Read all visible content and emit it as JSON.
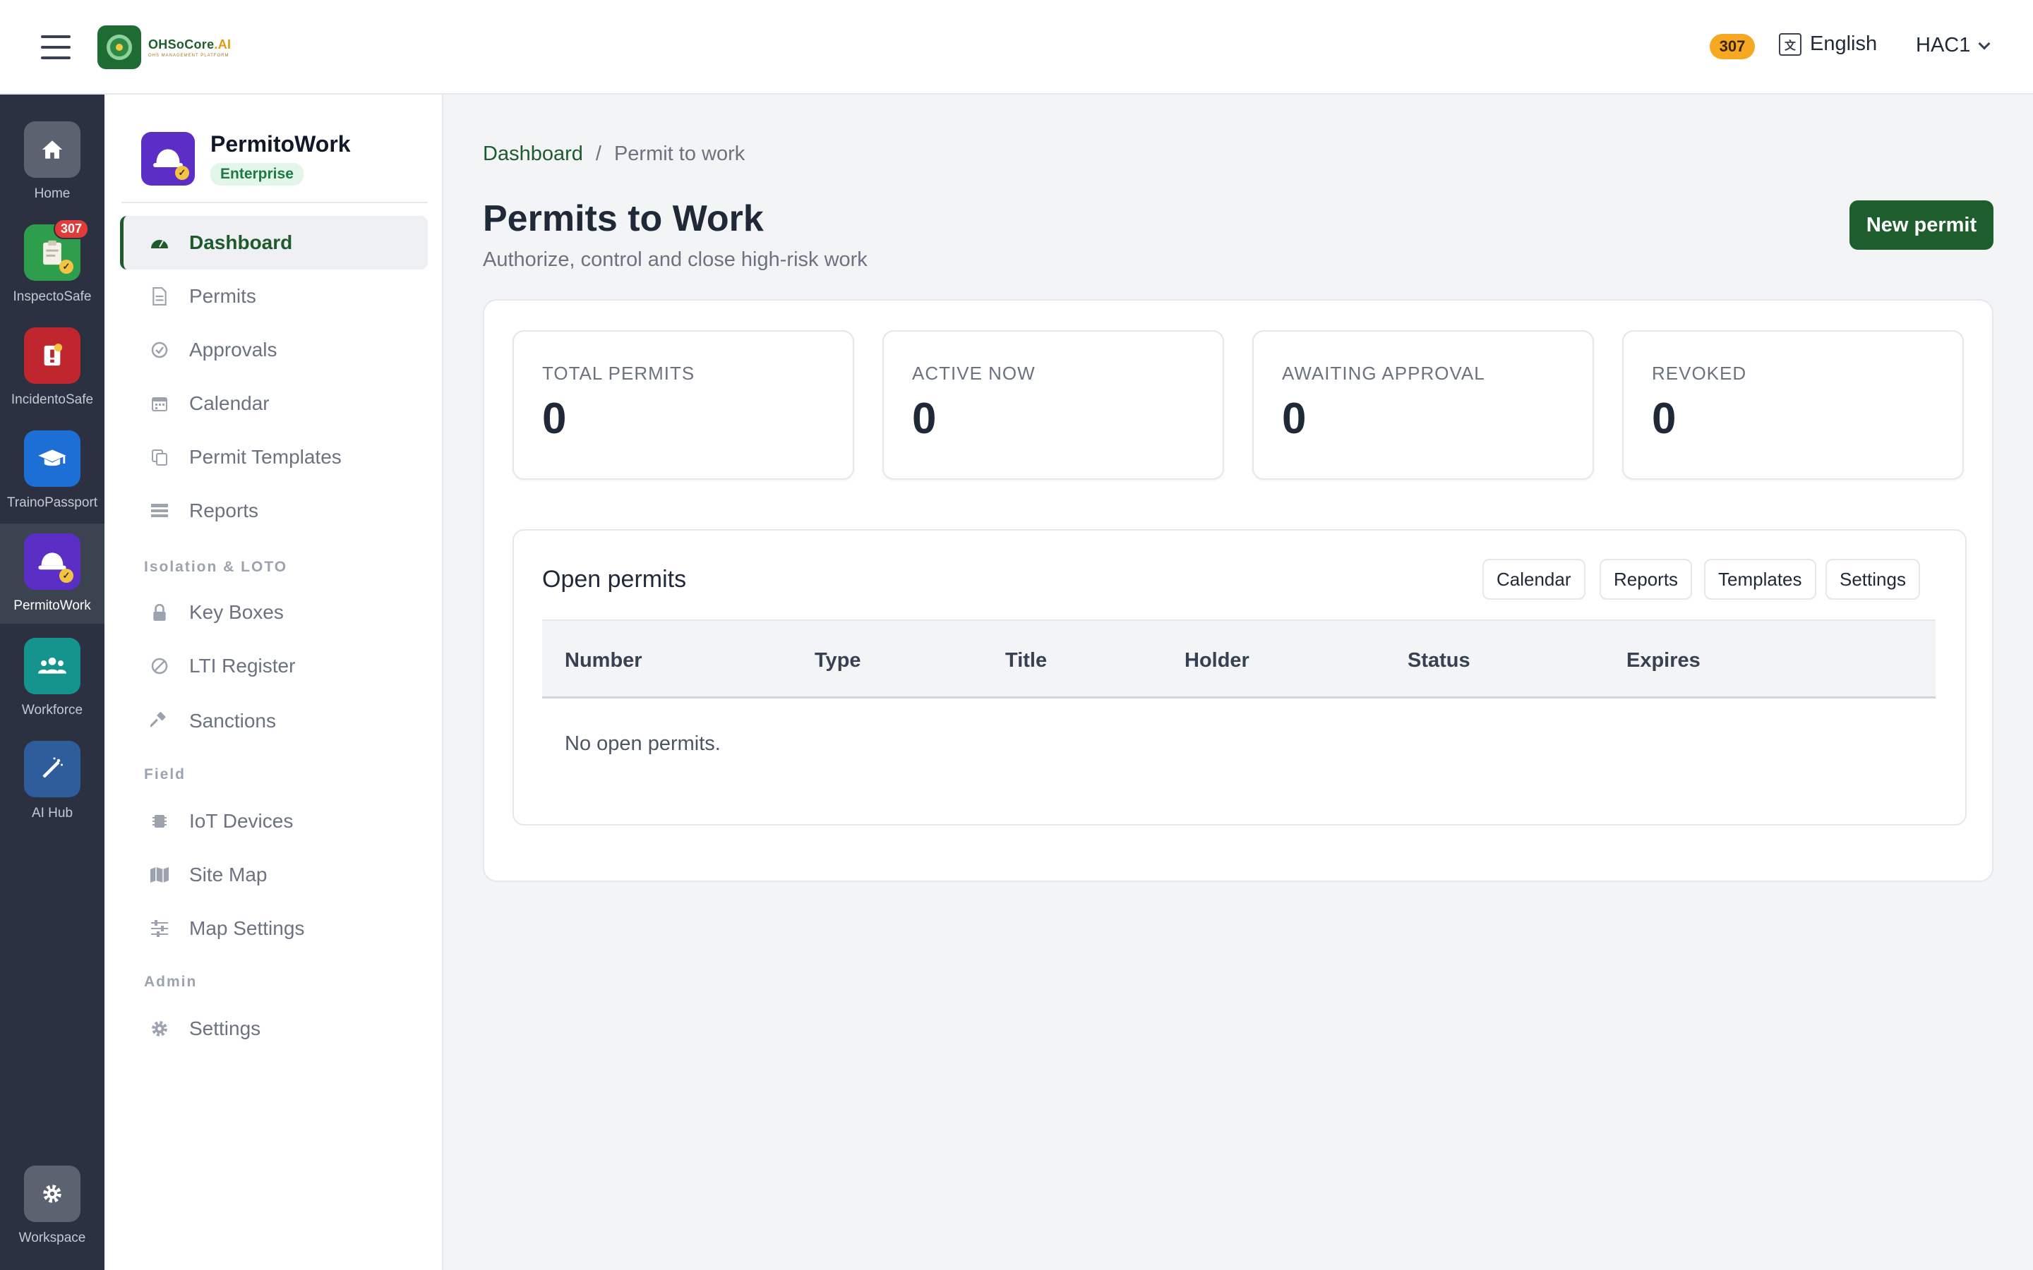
{
  "topbar": {
    "logo_name": "OHSoCore",
    "logo_suffix": ".AI",
    "logo_tagline": "OHS MANAGEMENT PLATFORM",
    "notification_count": "307",
    "language": "English",
    "user": "HAC1"
  },
  "rail": {
    "items": [
      {
        "label": "Home",
        "icon": "home-icon",
        "color": "#5c6370"
      },
      {
        "label": "InspectoSafe",
        "icon": "clipboard-check-icon",
        "color": "#2e9e4d",
        "badge": "307"
      },
      {
        "label": "IncidentoSafe",
        "icon": "alert-document-icon",
        "color": "#c0262d"
      },
      {
        "label": "TrainoPassport",
        "icon": "graduation-cap-icon",
        "color": "#1d6fd6"
      },
      {
        "label": "PermitoWork",
        "icon": "hard-hat-icon",
        "color": "#5b2fc6",
        "active": true
      },
      {
        "label": "Workforce",
        "icon": "people-icon",
        "color": "#15938d"
      },
      {
        "label": "AI Hub",
        "icon": "magic-wand-icon",
        "color": "#2f5c9a"
      }
    ],
    "workspace": {
      "label": "Workspace",
      "icon": "gear-icon"
    }
  },
  "module": {
    "name": "PermitoWork",
    "tier": "Enterprise",
    "nav": [
      {
        "label": "Dashboard",
        "icon": "dashboard-gauge-icon",
        "active": true
      },
      {
        "label": "Permits",
        "icon": "document-icon"
      },
      {
        "label": "Approvals",
        "icon": "check-circle-icon"
      },
      {
        "label": "Calendar",
        "icon": "calendar-icon"
      },
      {
        "label": "Permit Templates",
        "icon": "copy-icon"
      },
      {
        "label": "Reports",
        "icon": "report-list-icon"
      }
    ],
    "section_isolation": "Isolation & LOTO",
    "nav_isolation": [
      {
        "label": "Key Boxes",
        "icon": "lock-icon"
      },
      {
        "label": "LTI Register",
        "icon": "ban-icon"
      },
      {
        "label": "Sanctions",
        "icon": "gavel-icon"
      }
    ],
    "section_field": "Field",
    "nav_field": [
      {
        "label": "IoT Devices",
        "icon": "chip-icon"
      },
      {
        "label": "Site Map",
        "icon": "map-icon"
      },
      {
        "label": "Map Settings",
        "icon": "sliders-icon"
      }
    ],
    "section_admin": "Admin",
    "nav_admin": [
      {
        "label": "Settings",
        "icon": "gear-icon"
      }
    ]
  },
  "main": {
    "breadcrumb": {
      "root": "Dashboard",
      "separator": "/",
      "current": "Permit to work"
    },
    "title": "Permits to Work",
    "subtitle": "Authorize, control and close high-risk work",
    "new_button": "New permit",
    "stats": [
      {
        "label": "TOTAL PERMITS",
        "value": "0"
      },
      {
        "label": "ACTIVE NOW",
        "value": "0"
      },
      {
        "label": "AWAITING APPROVAL",
        "value": "0"
      },
      {
        "label": "REVOKED",
        "value": "0"
      }
    ],
    "open_permits": {
      "title": "Open permits",
      "actions": [
        "Calendar",
        "Reports",
        "Templates",
        "Settings"
      ],
      "columns": [
        "Number",
        "Type",
        "Title",
        "Holder",
        "Status",
        "Expires"
      ],
      "empty_message": "No open permits."
    }
  }
}
